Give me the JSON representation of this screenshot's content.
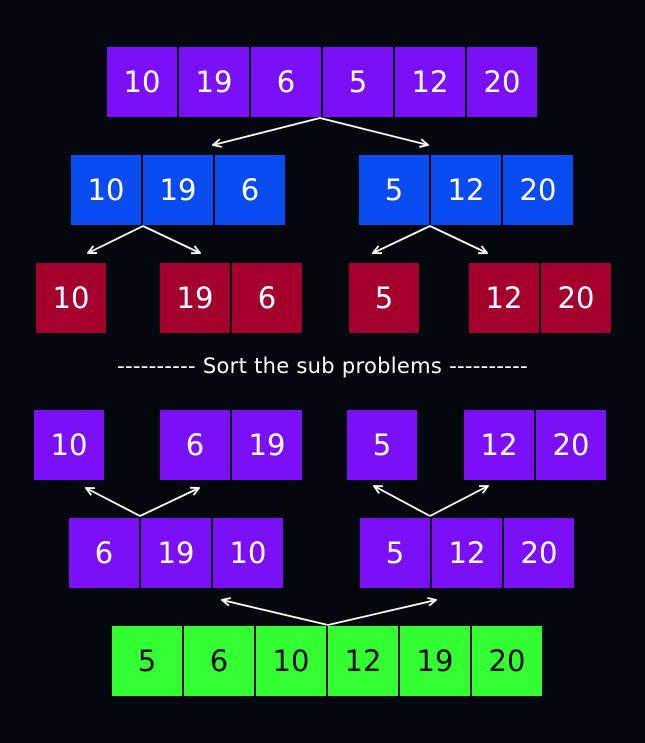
{
  "separator_text": "---------- Sort the sub problems ----------",
  "colors": {
    "background": "#05070f",
    "purple": "#7b0ff5",
    "blue": "#0a4cf0",
    "red": "#a3002e",
    "green": "#33ff33",
    "arrow": "#ffffff"
  },
  "groups": [
    {
      "id": "top-array",
      "color": "purple",
      "values": [
        "10",
        "19",
        "6",
        "5",
        "12",
        "20"
      ]
    },
    {
      "id": "split-left",
      "color": "blue",
      "values": [
        "10",
        "19",
        "6"
      ]
    },
    {
      "id": "split-right",
      "color": "blue",
      "values": [
        "5",
        "12",
        "20"
      ]
    },
    {
      "id": "leaf-10",
      "color": "red",
      "values": [
        "10"
      ]
    },
    {
      "id": "leaf-19-6",
      "color": "red",
      "values": [
        "19",
        "6"
      ]
    },
    {
      "id": "leaf-5",
      "color": "red",
      "values": [
        "5"
      ]
    },
    {
      "id": "leaf-12-20",
      "color": "red",
      "values": [
        "12",
        "20"
      ]
    },
    {
      "id": "sorted-leaf-10",
      "color": "purple",
      "values": [
        "10"
      ]
    },
    {
      "id": "sorted-leaf-6-19",
      "color": "purple",
      "values": [
        "6",
        "19"
      ]
    },
    {
      "id": "sorted-leaf-5",
      "color": "purple",
      "values": [
        "5"
      ]
    },
    {
      "id": "sorted-leaf-12-20",
      "color": "purple",
      "values": [
        "12",
        "20"
      ]
    },
    {
      "id": "merged-left",
      "color": "purple",
      "values": [
        "6",
        "19",
        "10"
      ]
    },
    {
      "id": "merged-right",
      "color": "purple",
      "values": [
        "5",
        "12",
        "20"
      ]
    },
    {
      "id": "final-array",
      "color": "green",
      "values": [
        "5",
        "6",
        "10",
        "12",
        "19",
        "20"
      ]
    }
  ]
}
